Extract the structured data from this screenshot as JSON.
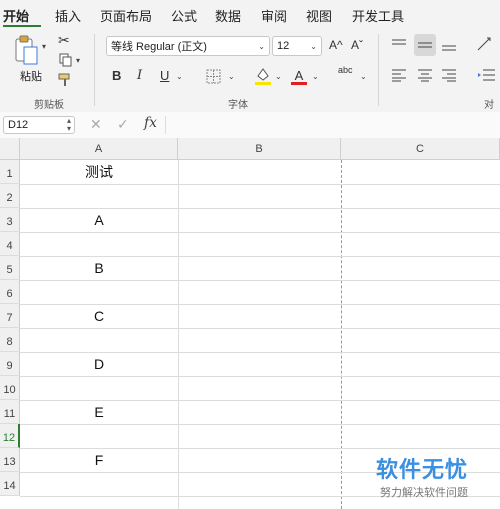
{
  "ribbon_tabs": [
    "开始",
    "插入",
    "页面布局",
    "公式",
    "数据",
    "审阅",
    "视图",
    "开发工具"
  ],
  "ribbon": {
    "clipboard": {
      "paste_label": "粘贴",
      "group_label": "剪贴板"
    },
    "font": {
      "font_name": "等线 Regular (正文)",
      "font_size": "12",
      "group_label": "字体",
      "bold": "B",
      "italic": "I",
      "underline": "U",
      "grow": "A^",
      "shrink": "Aˇ",
      "color_a": "A",
      "abc": "abc"
    },
    "alignment": {
      "group_label": "对齐"
    }
  },
  "formula_bar": {
    "name_box": "D12",
    "cancel": "✕",
    "confirm": "✓",
    "fx": "fx",
    "value": ""
  },
  "sheet": {
    "columns": [
      "A",
      "B",
      "C"
    ],
    "rows": [
      "1",
      "2",
      "3",
      "4",
      "5",
      "6",
      "7",
      "8",
      "9",
      "10",
      "11",
      "12",
      "13",
      "14"
    ],
    "selected_row": "12",
    "cells": {
      "A1": "测试",
      "A3": "A",
      "A5": "B",
      "A7": "C",
      "A9": "D",
      "A11": "E",
      "A13": "F"
    }
  },
  "watermark": {
    "title": "软件无忧",
    "subtitle": "努力解决软件问题"
  },
  "colors": {
    "accent": "#2e7d32",
    "watermark": "#3b8fe0"
  }
}
